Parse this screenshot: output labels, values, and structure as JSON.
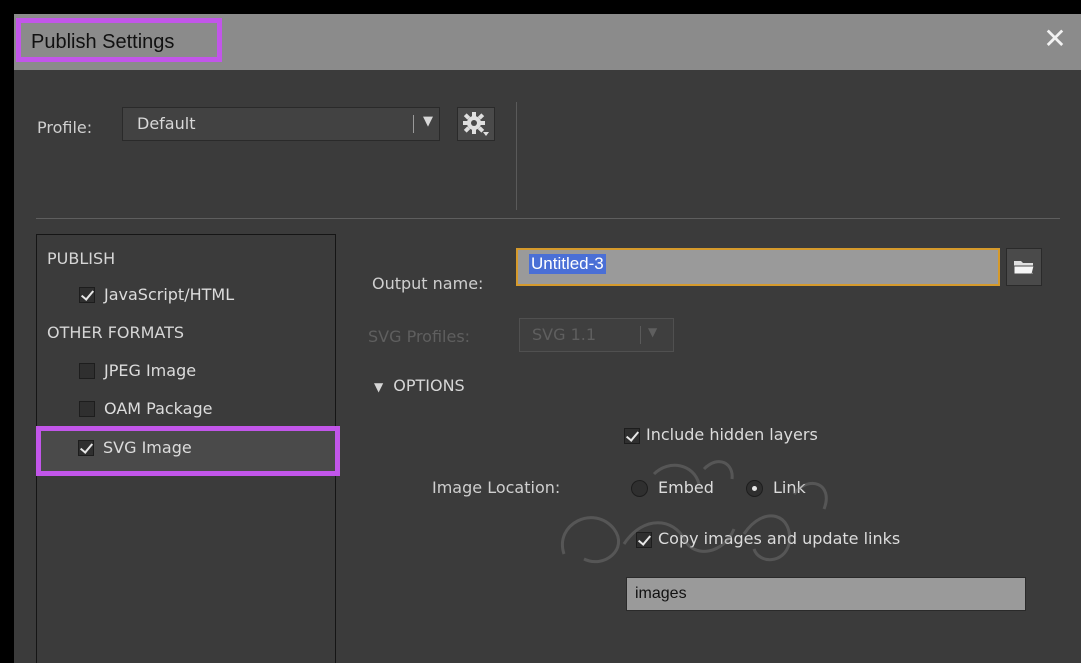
{
  "window": {
    "title": "Publish Settings",
    "close_glyph": "✕"
  },
  "profile": {
    "label": "Profile:",
    "value": "Default",
    "arrow": "▼"
  },
  "left_panel": {
    "publish_heading": "PUBLISH",
    "other_heading": "OTHER FORMATS",
    "items": [
      {
        "label": "JavaScript/HTML",
        "checked": true
      },
      {
        "label": "JPEG Image",
        "checked": false
      },
      {
        "label": "OAM Package",
        "checked": false
      },
      {
        "label": "SVG Image",
        "checked": true,
        "selected": true
      }
    ]
  },
  "output": {
    "label": "Output name:",
    "value": "Untitled-3"
  },
  "svg_profiles": {
    "label": "SVG Profiles:",
    "value": "SVG 1.1",
    "arrow": "▼"
  },
  "options": {
    "toggle_label": "OPTIONS",
    "toggle_glyph": "▼",
    "include_hidden_layers": {
      "label": "Include hidden layers",
      "checked": true
    },
    "image_location": {
      "label": "Image Location:",
      "embed_label": "Embed",
      "link_label": "Link",
      "selected": "Link"
    },
    "copy_images": {
      "label": "Copy images and update links",
      "checked": true
    },
    "images_folder": "images"
  },
  "icons": {
    "gear": "gear-icon",
    "folder": "folder-icon",
    "close": "close-icon"
  },
  "colors": {
    "highlight": "#c256ea",
    "focus_border": "#d59a2c",
    "selection": "#4a6fd6"
  }
}
